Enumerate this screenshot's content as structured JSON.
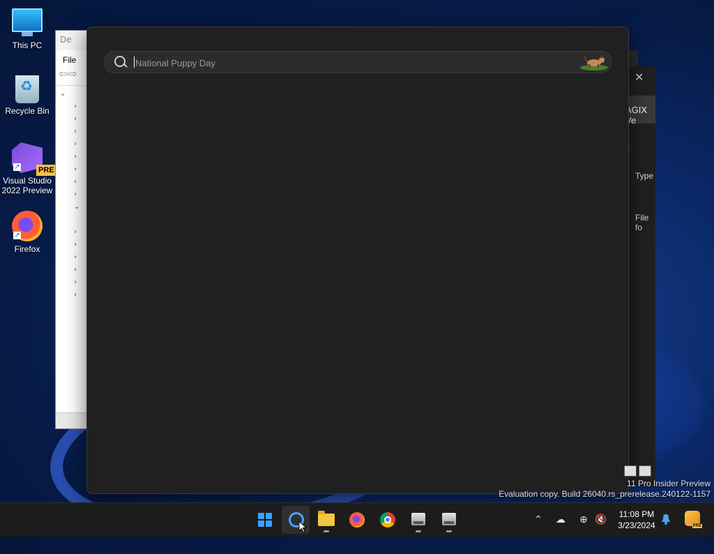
{
  "desktop": {
    "icons": [
      {
        "label": "This PC"
      },
      {
        "label": "Recycle Bin"
      },
      {
        "label": "Visual Studio 2022 Preview",
        "badge": "PRE"
      },
      {
        "label": "Firefox"
      }
    ]
  },
  "background_windows": {
    "device_manager": {
      "title_fragment": "De",
      "menu_file": "File"
    },
    "explorer": {
      "tab_fragment": "AGIX Ve",
      "details_fragment": "ails",
      "column_type": "Type",
      "row_type_fragment": "File fo"
    }
  },
  "search_flyout": {
    "input_placeholder": "National Puppy Day",
    "input_value": ""
  },
  "watermark": {
    "line1": "11 Pro Insider Preview",
    "line2": "Evaluation copy. Build 26040.rs_prerelease.240122-1157"
  },
  "taskbar": {
    "apps": [
      {
        "name": "start",
        "icon": "windows-icon"
      },
      {
        "name": "search",
        "icon": "search-icon",
        "active": true
      },
      {
        "name": "file-explorer",
        "icon": "folder-icon"
      },
      {
        "name": "firefox",
        "icon": "firefox-icon"
      },
      {
        "name": "chrome",
        "icon": "chrome-icon"
      },
      {
        "name": "device-manager-1",
        "icon": "device-manager-icon"
      },
      {
        "name": "device-manager-2",
        "icon": "device-manager-icon"
      }
    ],
    "clock": {
      "time": "11:08 PM",
      "date": "3/23/2024"
    },
    "copilot_badge": "PRE"
  },
  "colors": {
    "accent": "#4aa3ff",
    "flyout_bg": "#202020",
    "taskbar_bg": "#1c1c1c"
  }
}
